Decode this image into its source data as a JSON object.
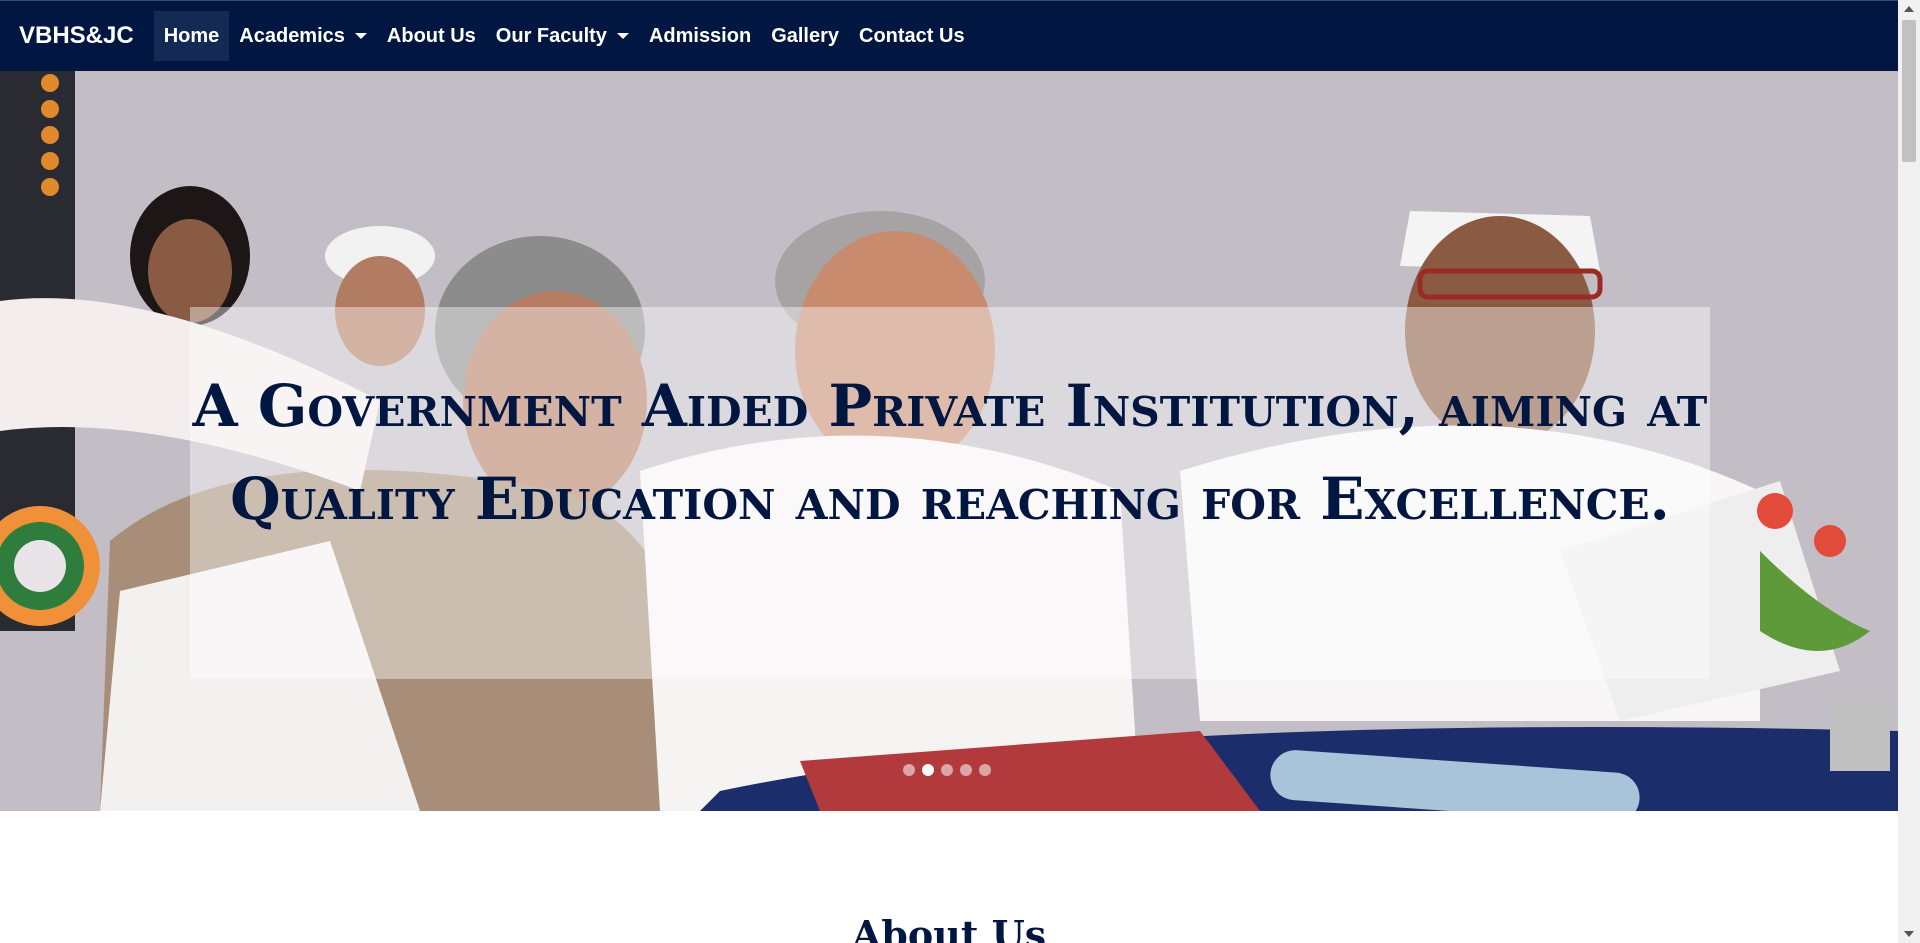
{
  "nav": {
    "brand": "VBHS&JC",
    "items": [
      {
        "label": "Home"
      },
      {
        "label": "Academics"
      },
      {
        "label": "About Us"
      },
      {
        "label": "Our Faculty"
      },
      {
        "label": "Admission"
      },
      {
        "label": "Gallery"
      },
      {
        "label": "Contact Us"
      }
    ]
  },
  "hero": {
    "heading": "A Government Aided Private Institution, aiming at Quality Education and reaching for Excellence.",
    "slides_total": 5,
    "active_slide": 2
  },
  "about": {
    "title": "About Us"
  },
  "colors": {
    "navy": "#011641",
    "white": "#ffffff"
  }
}
